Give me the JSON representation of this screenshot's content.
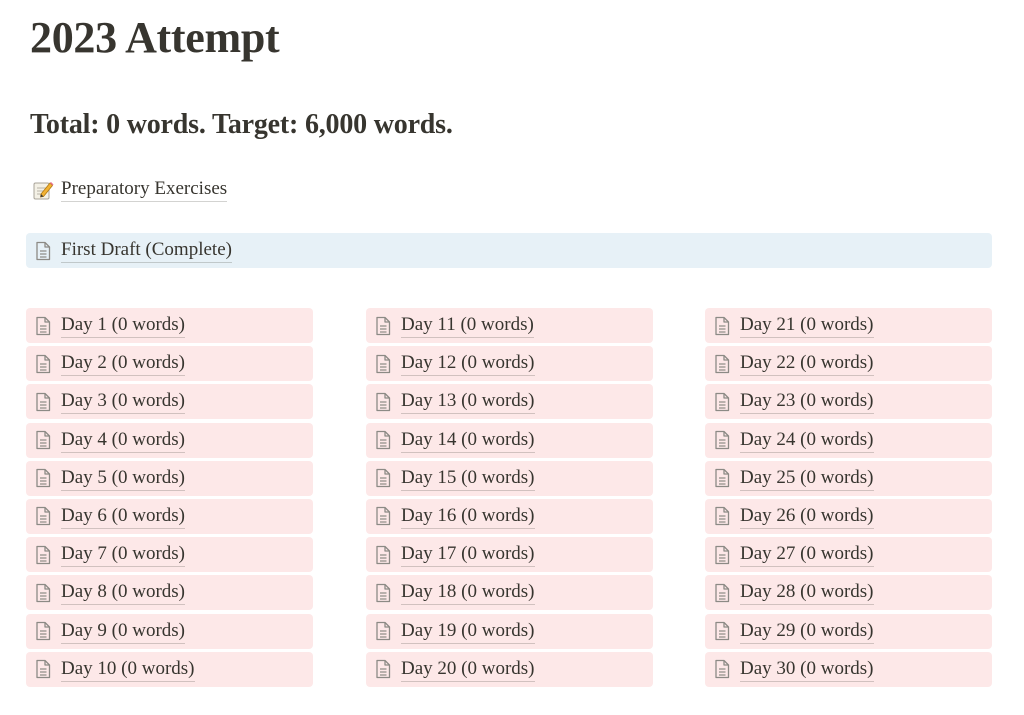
{
  "page": {
    "title": "2023 Attempt",
    "subtitle": "Total: 0 words. Target: 6,000 words."
  },
  "links": {
    "preparatory": {
      "label": "Preparatory Exercises",
      "icon": "memo-icon"
    },
    "first_draft": {
      "label": "First Draft (Complete)",
      "icon": "page-icon",
      "color": "#e7f1f7"
    }
  },
  "days": {
    "color": "#fde8e8",
    "icon": "page-icon",
    "columns": [
      [
        "Day 1 (0 words)",
        "Day 2 (0 words)",
        "Day 3 (0 words)",
        "Day 4 (0 words)",
        "Day 5 (0 words)",
        "Day 6 (0 words)",
        "Day 7 (0 words)",
        "Day 8 (0 words)",
        "Day 9 (0 words)",
        "Day 10 (0 words)"
      ],
      [
        "Day 11 (0 words)",
        "Day 12 (0 words)",
        "Day 13 (0 words)",
        "Day 14 (0 words)",
        "Day 15 (0 words)",
        "Day 16 (0 words)",
        "Day 17 (0 words)",
        "Day 18 (0 words)",
        "Day 19 (0 words)",
        "Day 20 (0 words)"
      ],
      [
        "Day 21 (0 words)",
        "Day 22 (0 words)",
        "Day 23 (0 words)",
        "Day 24 (0 words)",
        "Day 25 (0 words)",
        "Day 26 (0 words)",
        "Day 27 (0 words)",
        "Day 28 (0 words)",
        "Day 29 (0 words)",
        "Day 30 (0 words)"
      ]
    ]
  }
}
